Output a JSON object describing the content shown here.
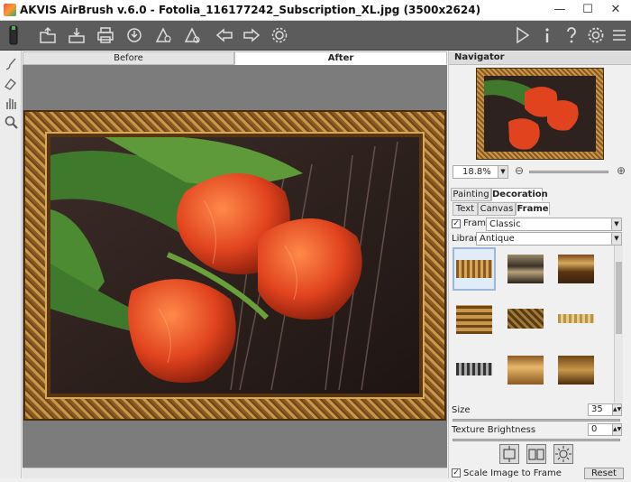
{
  "window": {
    "title": "AKVIS AirBrush v.6.0 - Fotolia_116177242_Subscription_XL.jpg (3500x2624)"
  },
  "window_controls": {
    "minimize": "—",
    "maximize": "☐",
    "close": "✕"
  },
  "toolbar": {
    "left_icons": [
      "open-icon",
      "save-icon",
      "print-icon",
      "share-icon",
      "batch-icon",
      "plugin-icon",
      "undo-arrow-icon",
      "redo-arrow-icon",
      "settings-gear-icon"
    ],
    "right_icons": [
      "run-icon",
      "info-icon",
      "help-icon",
      "preferences-icon",
      "extra-icon"
    ]
  },
  "left_tools": [
    "brush-icon",
    "eraser-icon",
    "hand-icon",
    "zoom-icon"
  ],
  "view_tabs": {
    "before": "Before",
    "after": "After",
    "active": "After"
  },
  "navigator": {
    "title": "Navigator",
    "zoom_value": "18.8%",
    "zoom_minus": "⊖",
    "zoom_plus": "⊕"
  },
  "main_tabs": {
    "painting": "Painting",
    "decoration": "Decoration",
    "active": "Decoration"
  },
  "sub_tabs": {
    "text": "Text",
    "canvas": "Canvas",
    "frame": "Frame",
    "active": "Frame"
  },
  "frame": {
    "checkbox_label": "Frame",
    "checked": true,
    "style_value": "Classic"
  },
  "library": {
    "label": "Library",
    "value": "Antique"
  },
  "gallery": {
    "thumbs": [
      "thumb-1",
      "thumb-2",
      "thumb-3",
      "thumb-4",
      "thumb-5",
      "thumb-6",
      "thumb-7",
      "thumb-8",
      "thumb-9"
    ],
    "selected": 0
  },
  "size": {
    "label": "Size",
    "value": "35"
  },
  "texture_brightness": {
    "label": "Texture Brightness",
    "value": "0"
  },
  "scale_option": {
    "label": "Scale Image to Frame",
    "checked": true
  },
  "reset_label": "Reset",
  "colors": {
    "toolbar": "#5c5c5c",
    "canvas_bg": "#7c7c7c",
    "frame_gold": "#c9974a",
    "frame_dark": "#4a2d0c",
    "tulip": "#e0431e"
  }
}
